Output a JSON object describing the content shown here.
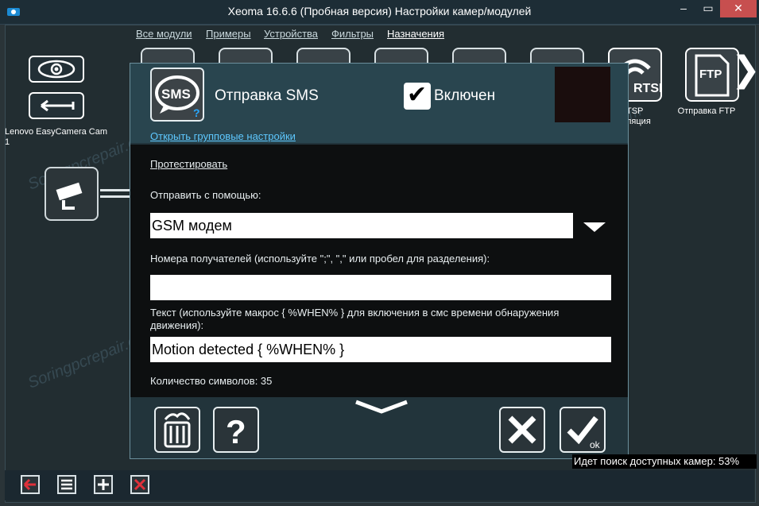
{
  "window": {
    "title": "Xeoma 16.6.6 (Пробная версия) Настройки камер/модулей",
    "minimize_glyph": "‒",
    "maximize_glyph": "▭",
    "close_glyph": "✕"
  },
  "menu": {
    "items": [
      "Все модули",
      "Примеры",
      "Устройства",
      "Фильтры",
      "Назначения"
    ],
    "active_index": 4
  },
  "camera": {
    "name": "Lenovo EasyCamera Cam 1"
  },
  "modules_row": [
    {
      "label": "RTSP",
      "caption": "RTSP трансляция",
      "caption_visible": "TSP\nляция"
    },
    {
      "label": "FTP",
      "caption": "Отправка FTP"
    }
  ],
  "dialog": {
    "title": "Отправка SMS",
    "icon_text": "SMS",
    "enabled_label": "Включен",
    "enabled": true,
    "group_settings_link": "Открыть групповые настройки",
    "test_link": "Протестировать",
    "send_via_label": "Отправить с помощью:",
    "send_via_value": "GSM модем",
    "recipients_label": "Номера получателей (используйте \";\", \",\" или пробел для разделения):",
    "recipients_value": "",
    "text_label": "Текст (используйте макрос { %WHEN% } для включения в смс времени обнаружения движения):",
    "text_value": "Motion detected { %WHEN% }",
    "char_count_label": "Количество символов: 35",
    "ok_label": "ok"
  },
  "status_text": "Идет поиск доступных камер: 53%",
  "watermark": "Soringpcrepair.com",
  "colors": {
    "link": "#5ec8ff",
    "dialog_bg": "#22343b",
    "accent_red": "#e0303a"
  },
  "icons": [
    "eye-icon",
    "back-arrow-icon",
    "camera-icon",
    "sms-icon",
    "trash-icon",
    "help-icon",
    "cancel-icon",
    "ok-check-icon",
    "chevron-down-icon",
    "chevron-right-icon"
  ]
}
